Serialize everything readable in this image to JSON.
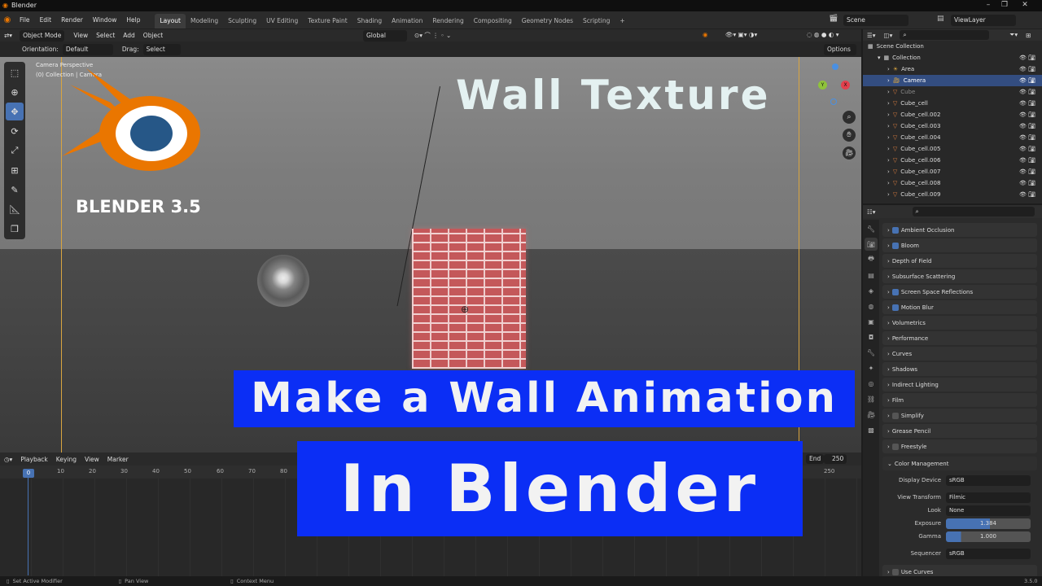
{
  "titlebar": {
    "title": "Blender"
  },
  "menubar": {
    "menus": [
      "File",
      "Edit",
      "Render",
      "Window",
      "Help"
    ],
    "workspaces": [
      "Layout",
      "Modeling",
      "Sculpting",
      "UV Editing",
      "Texture Paint",
      "Shading",
      "Animation",
      "Rendering",
      "Compositing",
      "Geometry Nodes",
      "Scripting"
    ],
    "active_workspace": "Layout",
    "add_tab": "+",
    "scene": "Scene",
    "view_layer": "ViewLayer"
  },
  "viewport_header": {
    "mode": "Object Mode",
    "menus": [
      "View",
      "Select",
      "Add",
      "Object"
    ],
    "transform_orientation": "Global",
    "orientation_label": "Orientation:",
    "orientation_value": "Default",
    "drag_label": "Drag:",
    "drag_value": "Select Box",
    "options": "Options"
  },
  "viewport": {
    "info_line1": "Camera Perspective",
    "info_line2": "(0) Collection | Camera",
    "overlay_title": "Wall Texture",
    "logo_caption": "BLENDER 3.5",
    "banner1": "Make a Wall Animation",
    "banner2": "In Blender",
    "gizmo": {
      "y": "Y",
      "x": "X",
      "z": "Z"
    }
  },
  "timeline": {
    "menus": [
      "Playback",
      "Keying",
      "View",
      "Marker"
    ],
    "ticks": [
      "0",
      "10",
      "20",
      "30",
      "40",
      "50",
      "60",
      "70",
      "80",
      "250"
    ],
    "current_frame": "0",
    "end_label": "End",
    "end_value": "250"
  },
  "outliner": {
    "root": "Scene Collection",
    "items": [
      {
        "label": "Collection",
        "selected": false
      },
      {
        "label": "Area",
        "selected": false
      },
      {
        "label": "Camera",
        "selected": true
      },
      {
        "label": "Cube",
        "selected": false
      },
      {
        "label": "Cube_cell",
        "selected": false
      },
      {
        "label": "Cube_cell.002",
        "selected": false
      },
      {
        "label": "Cube_cell.003",
        "selected": false
      },
      {
        "label": "Cube_cell.004",
        "selected": false
      },
      {
        "label": "Cube_cell.005",
        "selected": false
      },
      {
        "label": "Cube_cell.006",
        "selected": false
      },
      {
        "label": "Cube_cell.007",
        "selected": false
      },
      {
        "label": "Cube_cell.008",
        "selected": false
      },
      {
        "label": "Cube_cell.009",
        "selected": false
      }
    ]
  },
  "properties": {
    "panels": [
      {
        "label": "Ambient Occlusion",
        "checkbox": true
      },
      {
        "label": "Bloom",
        "checkbox": true
      },
      {
        "label": "Depth of Field",
        "checkbox": null
      },
      {
        "label": "Subsurface Scattering",
        "checkbox": null
      },
      {
        "label": "Screen Space Reflections",
        "checkbox": true
      },
      {
        "label": "Motion Blur",
        "checkbox": true
      },
      {
        "label": "Volumetrics",
        "checkbox": null
      },
      {
        "label": "Performance",
        "checkbox": null
      },
      {
        "label": "Curves",
        "checkbox": null
      },
      {
        "label": "Shadows",
        "checkbox": null
      },
      {
        "label": "Indirect Lighting",
        "checkbox": null
      },
      {
        "label": "Film",
        "checkbox": null
      },
      {
        "label": "Simplify",
        "checkbox": false
      },
      {
        "label": "Grease Pencil",
        "checkbox": null
      },
      {
        "label": "Freestyle",
        "checkbox": false
      }
    ],
    "color_management": {
      "title": "Color Management",
      "display_device_label": "Display Device",
      "display_device": "sRGB",
      "view_transform_label": "View Transform",
      "view_transform": "Filmic",
      "look_label": "Look",
      "look": "None",
      "exposure_label": "Exposure",
      "exposure": "1.384",
      "gamma_label": "Gamma",
      "gamma": "1.000",
      "sequencer_label": "Sequencer",
      "sequencer": "sRGB",
      "use_curves": "Use Curves"
    }
  },
  "statusbar": {
    "left": "Set Active Modifier",
    "mid": "Pan View",
    "right": "Context Menu",
    "version": "3.5.0"
  },
  "colors": {
    "accent": "#4772b3",
    "banner": "#0b2ef5",
    "logo_orange": "#ea7600",
    "logo_blue": "#265787",
    "camera_frame": "#d9a540"
  }
}
